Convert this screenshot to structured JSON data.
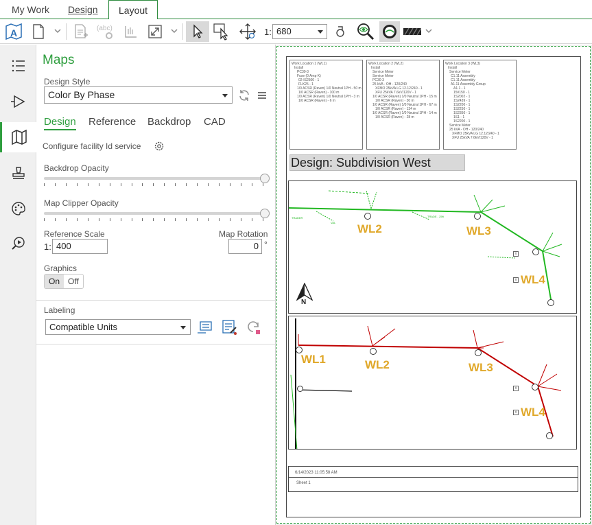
{
  "tabs": [
    {
      "label": "My Work"
    },
    {
      "label": "Design"
    },
    {
      "label": "Layout"
    }
  ],
  "toolbar": {
    "scale_prefix": "1:",
    "scale_value": "680",
    "colors": {
      "accent": "#2e9e3e",
      "selected_bg": "#d9d9d9"
    },
    "icons": [
      "map-layout-icon",
      "new-page-icon",
      "insert-page-icon",
      "text-label-icon",
      "measure-icon",
      "resize-icon",
      "select-pointer-icon",
      "select-area-icon",
      "pan-icon",
      "link-icon",
      "zoom-eye-icon",
      "hide-icon",
      "hatch-icon"
    ]
  },
  "rail": {
    "icons": [
      "list-icon",
      "play-icon",
      "map-icon",
      "stamp-icon",
      "palette-icon",
      "search-play-icon"
    ]
  },
  "panel": {
    "title": "Maps",
    "design_style_label": "Design Style",
    "design_style_value": "Color By Phase",
    "subtabs": [
      "Design",
      "Reference",
      "Backdrop",
      "CAD"
    ],
    "configure_label": "Configure facility Id service",
    "backdrop_opacity_label": "Backdrop Opacity",
    "map_clipper_opacity_label": "Map Clipper Opacity",
    "reference_scale_label": "Reference Scale",
    "reference_scale_prefix": "1:",
    "reference_scale_value": "400",
    "map_rotation_label": "Map Rotation",
    "map_rotation_value": "0",
    "map_rotation_unit": "°",
    "graphics_label": "Graphics",
    "graphics_on": "On",
    "graphics_off": "Off",
    "labeling_label": "Labeling",
    "labeling_value": "Compatible Units"
  },
  "sheet": {
    "notes": [
      {
        "lines": [
          "Work Location 1 (WL1)",
          "Install",
          "PC30-3",
          "Fuse (0 Amp K)",
          "02-IS2500 - 1",
          "FLK25 - 1",
          "1/0 ACSR (Raven) 1/0 Neutral 1PH - 50 m",
          "1/0 ACSR (Raven) - 100 m",
          "1/0 ACSR (Raven) 1/0 Neutral 1PH - 3 m",
          "1/0 ACSR (Raven) - 6 m"
        ]
      },
      {
        "lines": [
          "Work Location 2 (WL2)",
          "Install",
          "Service Meter",
          "Service Meter",
          "PC30-3",
          "25 kVA - OH - 120/240",
          "XFMO 25kVA LG 12.12/240 - 1",
          "XFU 25kVA 7.6kV/120V - 1",
          "1/0 ACSR (Raven) 1/0 Neutral 1PH - 15 m",
          "1/0 ACSR (Raven) - 30 m",
          "1/0 ACSR (Raven) 1/0 Neutral 1PH - 67 m",
          "1/0 ACSR (Raven) - 134 m",
          "1/0 ACSR (Raven) 1/0 Neutral 1PH - 14 m",
          "1/0 ACSR (Raven) - 28 m"
        ]
      },
      {
        "lines": [
          "Work Location 3 (WL3)",
          "Install",
          "Service Meter",
          "C1.11 Assembly",
          "C1.11 Assembly",
          "A1.11 Assembly Group",
          "A1.1 - 1",
          "15#150 - 1",
          "1S2002 - 1",
          "1S2439 - 1",
          "1S2200 - 1",
          "1S2250 - 1",
          "1S2350 - 1",
          "1S1 - 1",
          "1S2200 - 1",
          "Service Meter",
          "25 kVA - OH - 120/240",
          "XFMO 25kVA LG 12.12/240 - 1",
          "XFU 25kVA 7.6kV/120V - 1"
        ]
      }
    ],
    "design_title": "Design: Subdivision West",
    "map1_labels": [
      "WL2",
      "WL3",
      "WL4"
    ],
    "map1_small_labels": [
      "TRADER",
      "VAL",
      "TRADE - 25ft"
    ],
    "north_label": "N",
    "map2_labels": [
      "WL1",
      "WL2",
      "WL3",
      "WL4"
    ],
    "footer_date": "6/14/2023 11:05:58 AM",
    "footer_sheet": "Sheet 1",
    "colors": {
      "phase_green": "#22b822",
      "phase_red": "#c00000",
      "wl_label": "#e0a82a"
    }
  }
}
